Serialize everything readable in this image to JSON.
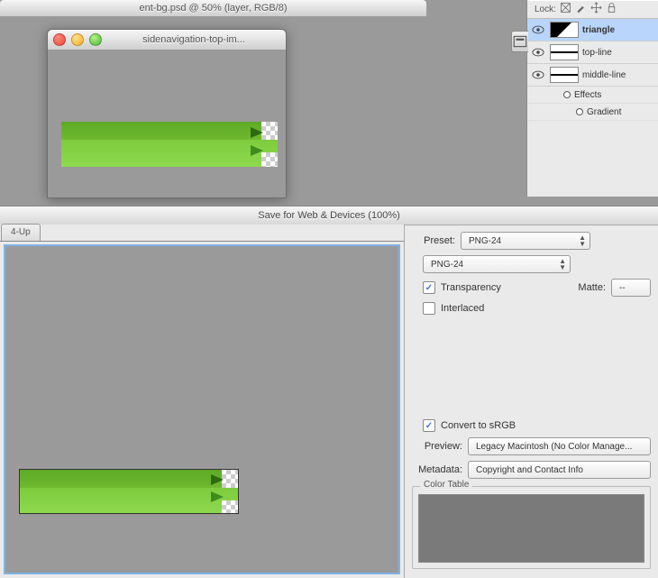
{
  "bg_window": {
    "title": "ent-bg.psd @ 50% (layer, RGB/8)"
  },
  "fg_window": {
    "title": "sidenavigation-top-im..."
  },
  "layers_panel": {
    "lock_label": "Lock:",
    "items": [
      {
        "name": "triangle",
        "selected": true,
        "thumb": "tri"
      },
      {
        "name": "top-line",
        "selected": false,
        "thumb": "line"
      },
      {
        "name": "middle-line",
        "selected": false,
        "thumb": "line"
      }
    ],
    "effects_label": "Effects",
    "gradient_label": "Gradient"
  },
  "sfw": {
    "title": "Save for Web & Devices (100%)",
    "tab_label": "4-Up",
    "preset_label": "Preset:",
    "preset_value": "PNG-24",
    "format_value": "PNG-24",
    "transparency_label": "Transparency",
    "interlaced_label": "Interlaced",
    "matte_label": "Matte:",
    "matte_value": "--",
    "convert_label": "Convert to sRGB",
    "preview_label": "Preview:",
    "preview_value": "Legacy Macintosh (No Color Manage...",
    "metadata_label": "Metadata:",
    "metadata_value": "Copyright and Contact Info",
    "color_table_label": "Color Table"
  }
}
